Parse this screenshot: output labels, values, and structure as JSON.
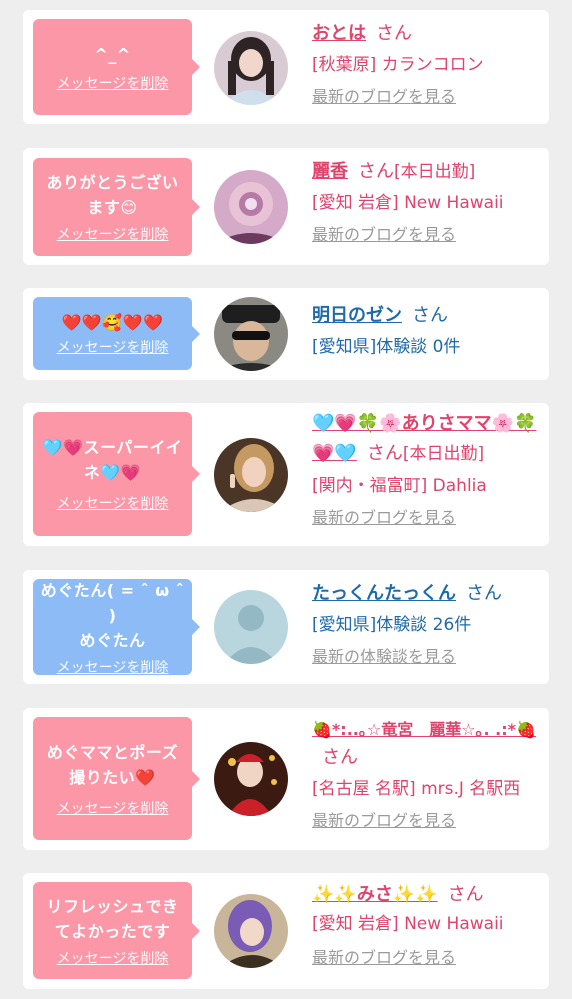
{
  "delete_label": "メッセージを削除",
  "colors": {
    "pink_bubble": "#fb97a7",
    "blue_bubble": "#8cbbf5",
    "pink_text": "#e0446c",
    "blue_text": "#1f6aab",
    "link_gray": "#9a9a9a"
  },
  "messages": [
    {
      "message": "^_^",
      "name": "おとは",
      "san": "さん",
      "status": "",
      "detail": "[秋葉原] カランコロン",
      "link": "最新のブログを見る",
      "bubble": "pink",
      "avatar": "girl-photo"
    },
    {
      "message": "ありがとうございます😊",
      "name": "麗香",
      "san": "さん",
      "status": "[本日出勤]",
      "detail": "[愛知 岩倉] New Hawaii",
      "link": "最新のブログを見る",
      "bubble": "pink",
      "avatar": "blurred-photo"
    },
    {
      "message": "❤️❤️🥰❤️❤️",
      "name": "明日のゼン",
      "san": "さん",
      "status": "",
      "detail": "[愛知県]体験談 0件",
      "link": "",
      "bubble": "blue",
      "avatar": "man-sunglasses-photo"
    },
    {
      "message": "🩵💗スーパーイイネ🩵💗",
      "name": "🩵💗🍀🌸ありさママ🌸🍀💗🩵",
      "san": "さん",
      "status": "[本日出勤]",
      "detail": "[関内・福富町] Dahlia",
      "link": "最新のブログを見る",
      "bubble": "pink",
      "avatar": "girl-peace-photo"
    },
    {
      "message": "めぐたん( = ˆ ω ˆ )\nめぐたん",
      "name": "たっくんたっくん",
      "san": "さん",
      "status": "",
      "detail": "[愛知県]体験談 26件",
      "link": "最新の体験談を見る",
      "bubble": "blue",
      "avatar": "no-photo"
    },
    {
      "message": "めぐママとポーズ撮りたい❤️",
      "name": "🍓*:..｡☆竜宮　麗華☆｡. .:*🍓",
      "san": "さん",
      "status": "",
      "detail": "[名古屋 名駅] mrs.J 名駅西",
      "link": "最新のブログを見る",
      "bubble": "pink",
      "avatar": "santa-photo"
    },
    {
      "message": "リフレッシュできてよかったです",
      "name": "✨✨みさ✨✨",
      "san": "さん",
      "status": "",
      "detail": "[愛知 岩倉] New Hawaii",
      "link": "最新のブログを見る",
      "bubble": "pink",
      "avatar": "purple-hair-photo"
    }
  ]
}
